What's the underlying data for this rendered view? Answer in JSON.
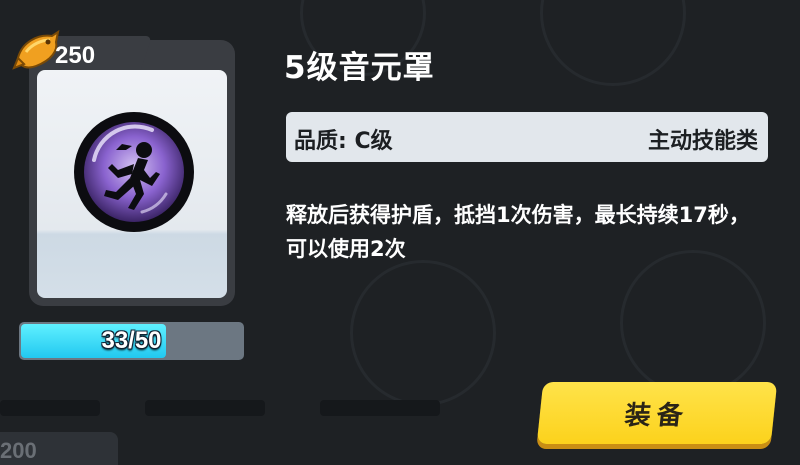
{
  "item": {
    "name": "5级音元罩",
    "price": "250",
    "icon": "purple-orb-runner-icon"
  },
  "progress": {
    "text": "33/50",
    "fraction": 0.66
  },
  "info": {
    "quality": "品质: C级",
    "category": "主动技能类"
  },
  "description": "释放后获得护盾，抵挡1次伤害，最长持续17秒，可以使用2次",
  "actions": {
    "equip_label": "装备"
  },
  "background": {
    "next_price": "200"
  },
  "colors": {
    "progress_fill": "#22c8f0",
    "button": "#fcd21c",
    "orb": "#7d55c8"
  }
}
